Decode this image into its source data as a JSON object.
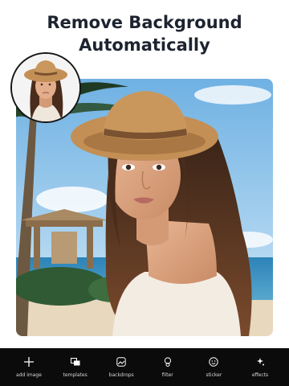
{
  "headline": {
    "line1": "Remove Background",
    "line2": "Automatically"
  },
  "toolbar": {
    "items": [
      {
        "label": "add image",
        "icon": "plus-icon"
      },
      {
        "label": "templates",
        "icon": "templates-icon"
      },
      {
        "label": "backdrops",
        "icon": "backdrops-icon"
      },
      {
        "label": "filter",
        "icon": "filter-icon"
      },
      {
        "label": "sticker",
        "icon": "sticker-icon"
      },
      {
        "label": "effects",
        "icon": "effects-icon"
      }
    ]
  },
  "colors": {
    "headline": "#1d2430",
    "toolbar_bg": "#0b0b0b",
    "toolbar_text": "#d8d8d8",
    "hat": "#c38f55"
  }
}
